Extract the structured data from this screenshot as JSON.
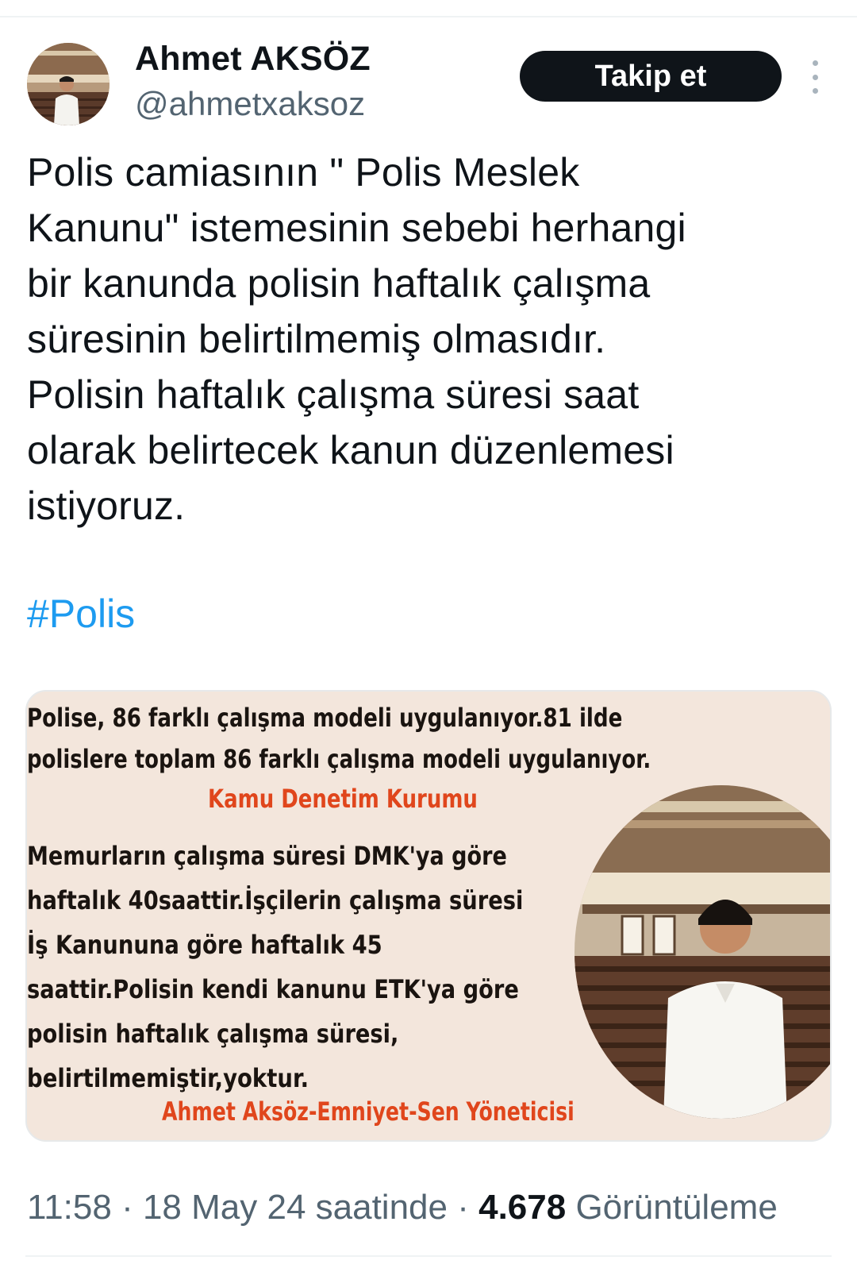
{
  "author": {
    "name": "Ahmet AKSÖZ",
    "handle": "@ahmetxaksoz",
    "avatar_icon": "profile-photo"
  },
  "follow_button": {
    "label": "Takip et"
  },
  "more_icon": "more-vertical-icon",
  "tweet": {
    "text": "Polis camiasının \" Polis Meslek\nKanunu\" istemesinin sebebi herhangi\nbir kanunda polisin haftalık çalışma\nsüresinin belirtilmemiş olmasıdır.\nPolisin haftalık çalışma süresi saat\nolarak belirtecek kanun düzenlemesi\nistiyoruz.",
    "hashtag": "#Polis"
  },
  "media": {
    "headline_line1": "Polise, 86 farklı çalışma modeli uygulanıyor.81 ilde",
    "headline_line2": "polislere toplam 86 farklı çalışma modeli uygulanıyor.",
    "source": "Kamu Denetim Kurumu",
    "body_line1": "Memurların çalışma süresi DMK'ya göre",
    "body_line2": "haftalık 40saattir.İşçilerin çalışma süresi",
    "body_line3": "İş Kanununa göre haftalık 45",
    "body_line4": "saattir.Polisin kendi kanunu ETK'ya göre",
    "body_line5": "polisin haftalık çalışma süresi,",
    "body_line6": "belirtilmemiştir,yoktur.",
    "signature": "Ahmet Aksöz-Emniyet-Sen Yöneticisi",
    "colors": {
      "background": "#f3e6dc",
      "accent": "#e0461c",
      "text": "#1a1410"
    }
  },
  "meta": {
    "time": "11:58",
    "separator1": " · ",
    "date": "18 May 24 saatinde",
    "separator2": " · ",
    "views_count": "4.678",
    "views_label": " Görüntüleme"
  }
}
